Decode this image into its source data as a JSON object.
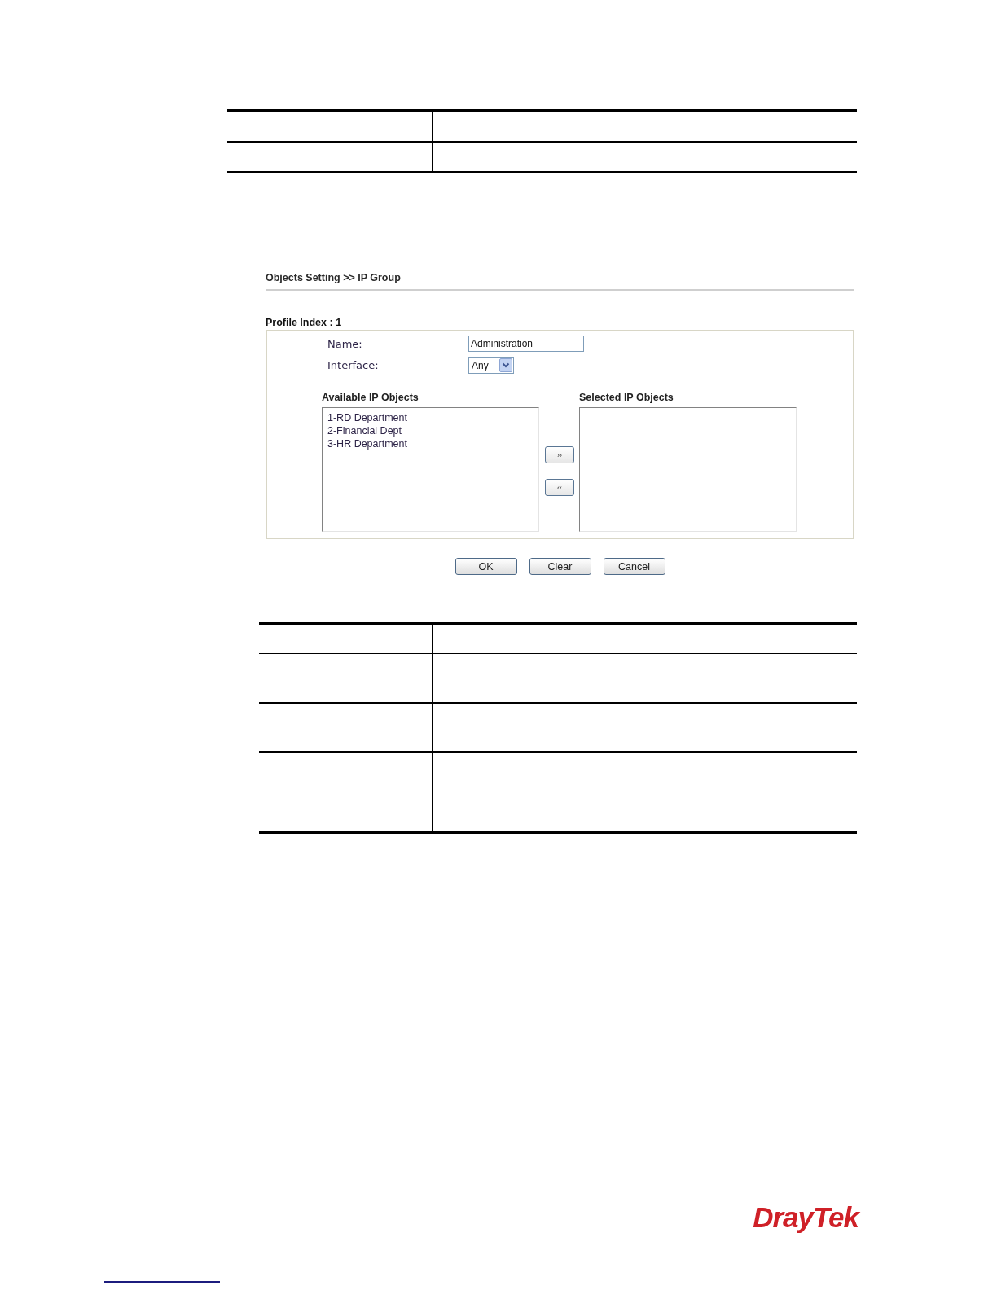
{
  "breadcrumb": "Objects Setting >> IP Group",
  "profile_index": "Profile Index : 1",
  "form": {
    "fields": [
      {
        "kind": "text",
        "label": "Name:",
        "value": "Administration"
      },
      {
        "kind": "select",
        "label": "Interface:",
        "value": "Any"
      }
    ]
  },
  "available": {
    "title": "Available IP Objects",
    "items": [
      {
        "label": "1-RD Department",
        "selected": false
      },
      {
        "label": "2-Financial Dept",
        "selected": false
      },
      {
        "label": "3-HR Department",
        "selected": false
      }
    ]
  },
  "selected_objects": {
    "title": "Selected IP Objects"
  },
  "move_buttons": [
    "››",
    "‹‹"
  ],
  "buttons": [
    "OK",
    "Clear",
    "Cancel"
  ],
  "logo": "DrayTek"
}
